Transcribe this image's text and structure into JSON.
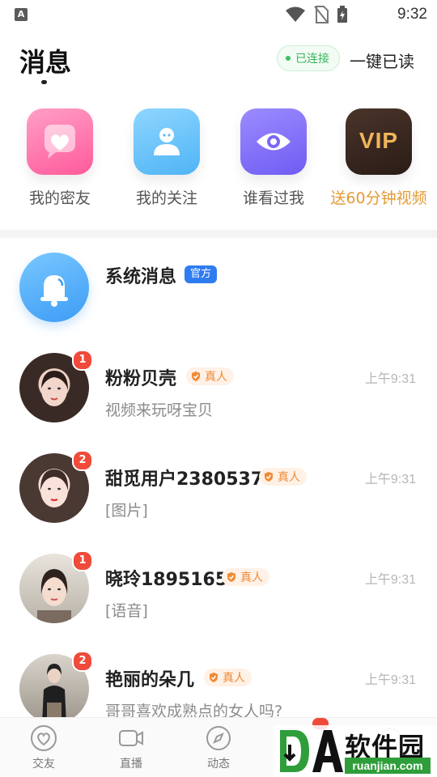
{
  "status_bar": {
    "left_icon_letter": "A",
    "time": "9:32"
  },
  "header": {
    "title": "消息",
    "connection_status": "已连接",
    "mark_all_read": "一键已读"
  },
  "quick_entries": [
    {
      "label": "我的密友",
      "icon": "heart-chat-icon",
      "color": "#ff6fa6"
    },
    {
      "label": "我的关注",
      "icon": "person-icon",
      "color": "#5bbcf5"
    },
    {
      "label": "谁看过我",
      "icon": "eye-icon",
      "color": "#7a68f5"
    },
    {
      "label": "送60分钟视频",
      "icon": "vip-icon",
      "icon_text": "VIP",
      "color": "#e39a35"
    }
  ],
  "system_message": {
    "name": "系统消息",
    "tag": "官方"
  },
  "messages": [
    {
      "name": "粉粉贝壳",
      "tag": "真人",
      "time": "上午9:31",
      "preview": "视频来玩呀宝贝",
      "unread": "1"
    },
    {
      "name": "甜觅用户2380537",
      "tag": "真人",
      "time": "上午9:31",
      "preview": "[图片]",
      "unread": "2"
    },
    {
      "name": "晓玲1895165",
      "tag": "真人",
      "time": "上午9:31",
      "preview": "[语音]",
      "unread": "1"
    },
    {
      "name": "艳丽的朵几",
      "tag": "真人",
      "time": "上午9:31",
      "preview": "哥哥喜欢成熟点的女人吗?",
      "unread": "2"
    }
  ],
  "bottom_nav": [
    {
      "label": "交友",
      "icon": "heart-outline-icon"
    },
    {
      "label": "直播",
      "icon": "video-camera-icon"
    },
    {
      "label": "动态",
      "icon": "compass-icon"
    }
  ],
  "watermark": {
    "text": "软件园",
    "url": "ruanjian.com"
  },
  "colors": {
    "accent_green": "#38b75c",
    "badge_red": "#f04a3a",
    "official_blue": "#2f7cf0",
    "real_orange": "#f08a35"
  }
}
